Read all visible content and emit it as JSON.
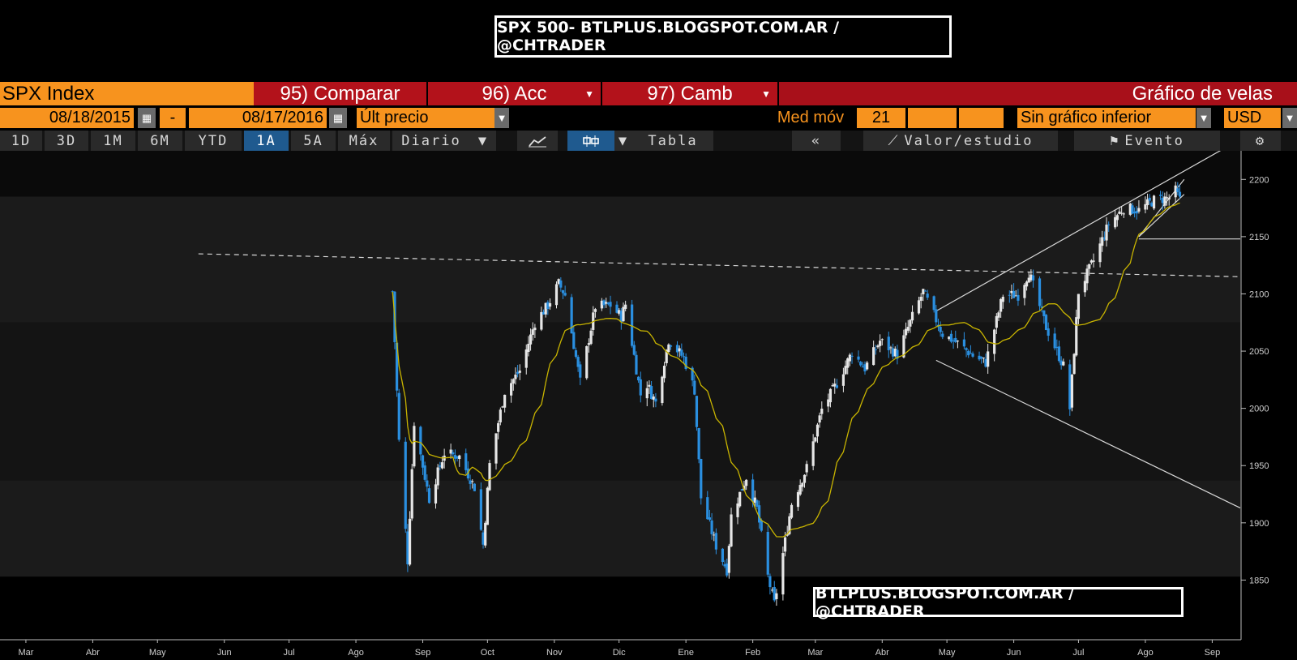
{
  "banner": "SPX 500- BTLPLUS.BLOGSPOT.COM.AR / @CHTRADER",
  "watermark": "BTLPLUS.BLOGSPOT.COM.AR / @CHTRADER",
  "toolbar1": {
    "ticker": "SPX Index",
    "compare": "95) Comparar",
    "actions": "96) Acc",
    "change": "97) Camb",
    "chart_kind": "Gráfico de velas"
  },
  "toolbar2": {
    "start_date": "08/18/2015",
    "dash": "-",
    "end_date": "08/17/2016",
    "field": "Últ precio",
    "ma_label": "Med móv",
    "ma_period": "21",
    "lower_chart": "Sin gráfico inferior",
    "currency": "USD"
  },
  "toolbar3": {
    "periods": [
      "1D",
      "3D",
      "1M",
      "6M",
      "YTD",
      "1A",
      "5A",
      "Máx"
    ],
    "active_period": "1A",
    "frequency": "Diario",
    "table": "Tabla",
    "study": "Valor/estudio",
    "event": "Evento"
  },
  "icons": [
    "calendar-icon",
    "dropdown-icon",
    "line-chart-icon",
    "candle-chart-icon",
    "double-chevron-left-icon",
    "study-icon",
    "flag-icon",
    "gear-icon"
  ],
  "colors": {
    "orange": "#f7931e",
    "red": "#b3121b",
    "up": "#e6e6e6",
    "down": "#2a8fe0",
    "ma": "#c8b400",
    "active": "#1f5a8f"
  },
  "chart_data": {
    "type": "line",
    "series": [
      {
        "points": [
          [
            "2015-08-18",
            2102
          ],
          [
            "2015-08-21",
            1971
          ],
          [
            "2015-08-25",
            1867
          ],
          [
            "2015-08-28",
            1988
          ],
          [
            "2015-09-04",
            1921
          ],
          [
            "2015-09-11",
            1961
          ],
          [
            "2015-09-18",
            1958
          ],
          [
            "2015-09-25",
            1931
          ],
          [
            "2015-09-29",
            1881
          ],
          [
            "2015-10-02",
            1951
          ],
          [
            "2015-10-09",
            2015
          ],
          [
            "2015-10-16",
            2033
          ],
          [
            "2015-10-23",
            2075
          ],
          [
            "2015-10-29",
            2090
          ],
          [
            "2015-11-03",
            2109
          ],
          [
            "2015-11-06",
            2099
          ],
          [
            "2015-11-13",
            2023
          ],
          [
            "2015-11-20",
            2089
          ],
          [
            "2015-11-27",
            2090
          ],
          [
            "2015-12-02",
            2080
          ],
          [
            "2015-12-04",
            2091
          ],
          [
            "2015-12-11",
            2012
          ],
          [
            "2015-12-14",
            2021
          ],
          [
            "2015-12-18",
            2005
          ],
          [
            "2015-12-24",
            2060
          ],
          [
            "2015-12-31",
            2044
          ],
          [
            "2016-01-05",
            2016
          ],
          [
            "2016-01-08",
            1922
          ],
          [
            "2016-01-15",
            1880
          ],
          [
            "2016-01-20",
            1859
          ],
          [
            "2016-01-22",
            1906
          ],
          [
            "2016-01-29",
            1940
          ],
          [
            "2016-02-03",
            1912
          ],
          [
            "2016-02-08",
            1853
          ],
          [
            "2016-02-11",
            1829
          ],
          [
            "2016-02-19",
            1917
          ],
          [
            "2016-02-26",
            1948
          ],
          [
            "2016-03-04",
            1999
          ],
          [
            "2016-03-11",
            2022
          ],
          [
            "2016-03-18",
            2049
          ],
          [
            "2016-03-24",
            2035
          ],
          [
            "2016-03-31",
            2059
          ],
          [
            "2016-04-08",
            2047
          ],
          [
            "2016-04-15",
            2080
          ],
          [
            "2016-04-20",
            2102
          ],
          [
            "2016-04-29",
            2065
          ],
          [
            "2016-05-06",
            2057
          ],
          [
            "2016-05-13",
            2046
          ],
          [
            "2016-05-19",
            2040
          ],
          [
            "2016-05-27",
            2099
          ],
          [
            "2016-06-03",
            2099
          ],
          [
            "2016-06-08",
            2119
          ],
          [
            "2016-06-16",
            2071
          ],
          [
            "2016-06-24",
            2037
          ],
          [
            "2016-06-27",
            2000
          ],
          [
            "2016-07-01",
            2102
          ],
          [
            "2016-07-08",
            2129
          ],
          [
            "2016-07-15",
            2161
          ],
          [
            "2016-07-22",
            2175
          ],
          [
            "2016-07-29",
            2173
          ],
          [
            "2016-08-05",
            2182
          ],
          [
            "2016-08-12",
            2184
          ],
          [
            "2016-08-15",
            2190
          ],
          [
            "2016-08-17",
            2182
          ]
        ]
      }
    ],
    "xlim": [
      "2015-02-17",
      "2016-09-14"
    ],
    "ylim": [
      1800,
      2225
    ],
    "x_ticks": [
      "Mar",
      "Abr",
      "May",
      "Jun",
      "Jul",
      "Ago",
      "Sep",
      "Oct",
      "Nov",
      "Dic",
      "Ene",
      "Feb",
      "Mar",
      "Abr",
      "May",
      "Jun",
      "Jul",
      "Ago",
      "Sep"
    ],
    "y_ticks": [
      1850,
      1900,
      1950,
      2000,
      2050,
      2100,
      2150,
      2200
    ],
    "grid": false,
    "trendlines": [
      {
        "from": [
          "2015-05-20",
          2135
        ],
        "to": [
          "2016-09-14",
          2115
        ],
        "style": "dashed"
      },
      {
        "from": [
          "2016-04-26",
          2085
        ],
        "to": [
          "2016-09-14",
          2235
        ],
        "style": "solid"
      },
      {
        "from": [
          "2016-04-26",
          2042
        ],
        "to": [
          "2016-09-14",
          1913
        ],
        "style": "solid"
      },
      {
        "from": [
          "2016-07-29",
          2148
        ],
        "to": [
          "2016-09-14",
          2148
        ],
        "style": "solid"
      },
      {
        "from": [
          "2016-07-29",
          2150
        ],
        "to": [
          "2016-08-19",
          2200
        ],
        "style": "solid"
      },
      {
        "from": [
          "2016-07-29",
          2150
        ],
        "to": [
          "2016-08-19",
          2187
        ],
        "style": "solid"
      }
    ]
  }
}
